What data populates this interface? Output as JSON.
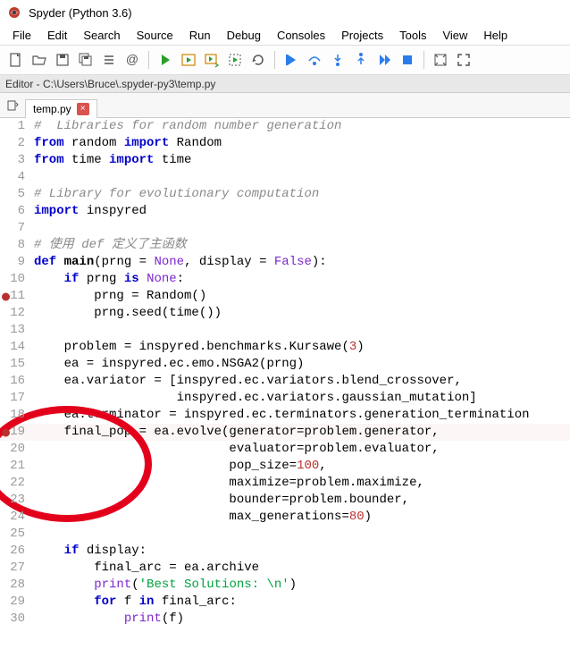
{
  "window": {
    "title": "Spyder (Python 3.6)"
  },
  "menu": {
    "items": [
      "File",
      "Edit",
      "Search",
      "Source",
      "Run",
      "Debug",
      "Consoles",
      "Projects",
      "Tools",
      "View",
      "Help"
    ]
  },
  "editor": {
    "header": "Editor - C:\\Users\\Bruce\\.spyder-py3\\temp.py",
    "tab_label": "temp.py"
  },
  "code": {
    "lines": [
      {
        "n": 1,
        "bp": false,
        "hl": false,
        "tokens": [
          [
            "comment",
            "#  Libraries for random number generation"
          ]
        ]
      },
      {
        "n": 2,
        "bp": false,
        "hl": false,
        "tokens": [
          [
            "keyword",
            "from"
          ],
          [
            "normal",
            " random "
          ],
          [
            "keyword",
            "import"
          ],
          [
            "normal",
            " Random"
          ]
        ]
      },
      {
        "n": 3,
        "bp": false,
        "hl": false,
        "tokens": [
          [
            "keyword",
            "from"
          ],
          [
            "normal",
            " time "
          ],
          [
            "keyword",
            "import"
          ],
          [
            "normal",
            " time"
          ]
        ]
      },
      {
        "n": 4,
        "bp": false,
        "hl": false,
        "tokens": [
          [
            "normal",
            ""
          ]
        ]
      },
      {
        "n": 5,
        "bp": false,
        "hl": false,
        "tokens": [
          [
            "comment",
            "# Library for evolutionary computation"
          ]
        ]
      },
      {
        "n": 6,
        "bp": false,
        "hl": false,
        "tokens": [
          [
            "keyword",
            "import"
          ],
          [
            "normal",
            " inspyred"
          ]
        ]
      },
      {
        "n": 7,
        "bp": false,
        "hl": false,
        "tokens": [
          [
            "normal",
            ""
          ]
        ]
      },
      {
        "n": 8,
        "bp": false,
        "hl": false,
        "tokens": [
          [
            "comment",
            "# 使用 def 定义了主函数"
          ]
        ]
      },
      {
        "n": 9,
        "bp": false,
        "hl": false,
        "tokens": [
          [
            "keyword",
            "def"
          ],
          [
            "normal",
            " "
          ],
          [
            "defname",
            "main"
          ],
          [
            "normal",
            "(prng = "
          ],
          [
            "builtin",
            "None"
          ],
          [
            "normal",
            ", display = "
          ],
          [
            "builtin",
            "False"
          ],
          [
            "normal",
            "):"
          ]
        ]
      },
      {
        "n": 10,
        "bp": false,
        "hl": false,
        "tokens": [
          [
            "normal",
            "    "
          ],
          [
            "keyword",
            "if"
          ],
          [
            "normal",
            " prng "
          ],
          [
            "keyword",
            "is"
          ],
          [
            "normal",
            " "
          ],
          [
            "builtin",
            "None"
          ],
          [
            "normal",
            ":"
          ]
        ]
      },
      {
        "n": 11,
        "bp": true,
        "hl": false,
        "tokens": [
          [
            "normal",
            "        prng = Random()"
          ]
        ]
      },
      {
        "n": 12,
        "bp": false,
        "hl": false,
        "tokens": [
          [
            "normal",
            "        prng.seed(time())"
          ]
        ]
      },
      {
        "n": 13,
        "bp": false,
        "hl": false,
        "tokens": [
          [
            "normal",
            ""
          ]
        ]
      },
      {
        "n": 14,
        "bp": false,
        "hl": false,
        "tokens": [
          [
            "normal",
            "    problem = inspyred.benchmarks.Kursawe("
          ],
          [
            "number",
            "3"
          ],
          [
            "normal",
            ")"
          ]
        ]
      },
      {
        "n": 15,
        "bp": false,
        "hl": false,
        "tokens": [
          [
            "normal",
            "    ea = inspyred.ec.emo.NSGA2(prng)"
          ]
        ]
      },
      {
        "n": 16,
        "bp": false,
        "hl": false,
        "tokens": [
          [
            "normal",
            "    ea.variator = [inspyred.ec.variators.blend_crossover,"
          ]
        ]
      },
      {
        "n": 17,
        "bp": false,
        "hl": false,
        "tokens": [
          [
            "normal",
            "                   inspyred.ec.variators.gaussian_mutation]"
          ]
        ]
      },
      {
        "n": 18,
        "bp": false,
        "hl": false,
        "tokens": [
          [
            "normal",
            "    ea.terminator = inspyred.ec.terminators.generation_termination"
          ]
        ]
      },
      {
        "n": 19,
        "bp": true,
        "hl": true,
        "tokens": [
          [
            "normal",
            "    final_pop = ea.evolve(generator=problem.generator,"
          ]
        ]
      },
      {
        "n": 20,
        "bp": false,
        "hl": false,
        "tokens": [
          [
            "normal",
            "                          evaluator=problem.evaluator,"
          ]
        ]
      },
      {
        "n": 21,
        "bp": false,
        "hl": false,
        "tokens": [
          [
            "normal",
            "                          pop_size="
          ],
          [
            "number",
            "100"
          ],
          [
            "normal",
            ","
          ]
        ]
      },
      {
        "n": 22,
        "bp": false,
        "hl": false,
        "tokens": [
          [
            "normal",
            "                          maximize=problem.maximize,"
          ]
        ]
      },
      {
        "n": 23,
        "bp": false,
        "hl": false,
        "tokens": [
          [
            "normal",
            "                          bounder=problem.bounder,"
          ]
        ]
      },
      {
        "n": 24,
        "bp": false,
        "hl": false,
        "tokens": [
          [
            "normal",
            "                          max_generations="
          ],
          [
            "number",
            "80"
          ],
          [
            "normal",
            ")"
          ]
        ]
      },
      {
        "n": 25,
        "bp": false,
        "hl": false,
        "tokens": [
          [
            "normal",
            ""
          ]
        ]
      },
      {
        "n": 26,
        "bp": false,
        "hl": false,
        "tokens": [
          [
            "normal",
            "    "
          ],
          [
            "keyword",
            "if"
          ],
          [
            "normal",
            " display:"
          ]
        ]
      },
      {
        "n": 27,
        "bp": false,
        "hl": false,
        "tokens": [
          [
            "normal",
            "        final_arc = ea.archive"
          ]
        ]
      },
      {
        "n": 28,
        "bp": false,
        "hl": false,
        "tokens": [
          [
            "normal",
            "        "
          ],
          [
            "builtin",
            "print"
          ],
          [
            "normal",
            "("
          ],
          [
            "string",
            "'Best Solutions: \\n'"
          ],
          [
            "normal",
            ")"
          ]
        ]
      },
      {
        "n": 29,
        "bp": false,
        "hl": false,
        "tokens": [
          [
            "normal",
            "        "
          ],
          [
            "keyword",
            "for"
          ],
          [
            "normal",
            " f "
          ],
          [
            "keyword",
            "in"
          ],
          [
            "normal",
            " final_arc:"
          ]
        ]
      },
      {
        "n": 30,
        "bp": false,
        "hl": false,
        "tokens": [
          [
            "normal",
            "            "
          ],
          [
            "builtin",
            "print"
          ],
          [
            "normal",
            "(f)"
          ]
        ]
      }
    ]
  }
}
